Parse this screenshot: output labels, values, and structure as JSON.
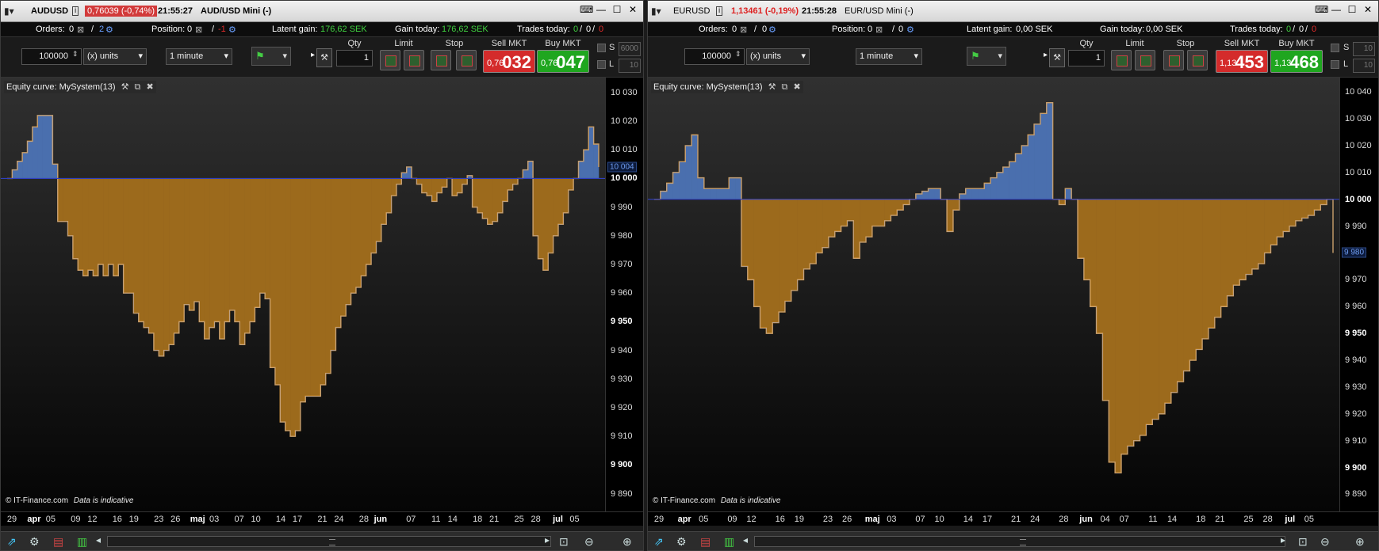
{
  "panels": [
    {
      "title": {
        "symbol": "AUDUSD",
        "price": "0,76039 (-0,74%)",
        "time": "21:55:27",
        "instrument": "AUD/USD Mini (-)"
      },
      "info": {
        "orders_label": "Orders:",
        "orders_value": "0",
        "orders_sep": "/",
        "orders_total": "2",
        "position_label": "Position:",
        "position_value": "0",
        "position_sep": "/",
        "position_total": "-1",
        "latent_label": "Latent gain:",
        "latent_value": "176,62 SEK",
        "gain_label": "Gain today:",
        "gain_value": "176,62 SEK",
        "trades_label": "Trades today:",
        "trades_a": "0",
        "trades_b": "0",
        "trades_c": "0"
      },
      "order": {
        "quantity": "100000",
        "units": "(x) units",
        "timeframe": "1 minute",
        "qty_label": "Qty",
        "qty_value": "1",
        "limit_label": "Limit",
        "stop_label": "Stop",
        "sell_label": "Sell MKT",
        "buy_label": "Buy MKT",
        "sell_small": "0,76",
        "sell_big": "032",
        "buy_small": "0,76",
        "buy_big": "047",
        "s_label": "S",
        "l_label": "L",
        "s_value": "6000",
        "l_value": "10"
      },
      "chart": {
        "title": "Equity curve: MySystem(13)",
        "copyright": "© IT-Finance.com",
        "indicative": "Data is indicative",
        "current_marker": "10 004"
      },
      "chart_data": {
        "type": "area",
        "baseline": 10000,
        "ylim": [
          9886,
          10033
        ],
        "yticks": [
          "10 030",
          "10 020",
          "10 010",
          "10 000",
          "9 990",
          "9 980",
          "9 970",
          "9 960",
          "9 950",
          "9 940",
          "9 930",
          "9 920",
          "9 910",
          "9 900",
          "9 890"
        ],
        "ytick_values": [
          10030,
          10020,
          10010,
          10000,
          9990,
          9980,
          9970,
          9960,
          9950,
          9940,
          9930,
          9920,
          9910,
          9900,
          9890
        ],
        "ytick_bold": [
          false,
          false,
          false,
          true,
          false,
          false,
          false,
          false,
          true,
          false,
          false,
          false,
          false,
          true,
          false
        ],
        "xlabels": [
          "29",
          "apr",
          "05",
          "09",
          "12",
          "16",
          "19",
          "23",
          "26",
          "maj",
          "03",
          "07",
          "10",
          "14",
          "17",
          "21",
          "24",
          "28",
          "jun",
          "07",
          "11",
          "14",
          "18",
          "21",
          "25",
          "28",
          "jul",
          "05"
        ],
        "xlabel_index": [
          0,
          0.8,
          1.4,
          2.3,
          2.9,
          3.8,
          4.4,
          5.3,
          5.9,
          6.7,
          7.3,
          8.2,
          8.8,
          9.7,
          10.3,
          11.2,
          11.8,
          12.7,
          13.3,
          14.4,
          15.3,
          15.9,
          16.8,
          17.4,
          18.3,
          18.9,
          19.7,
          20.3
        ],
        "xlabel_bold": [
          false,
          true,
          false,
          false,
          false,
          false,
          false,
          false,
          false,
          true,
          false,
          false,
          false,
          false,
          false,
          false,
          false,
          false,
          true,
          false,
          false,
          false,
          false,
          false,
          false,
          false,
          true,
          false
        ],
        "x_span": 21,
        "values": [
          10000,
          10003,
          10006,
          10009,
          10013,
          10018,
          10022,
          10022,
          10022,
          10005,
          9985,
          9985,
          9980,
          9972,
          9968,
          9966,
          9968,
          9966,
          9970,
          9966,
          9970,
          9966,
          9970,
          9960,
          9960,
          9953,
          9950,
          9948,
          9946,
          9940,
          9938,
          9940,
          9942,
          9946,
          9950,
          9956,
          9954,
          9957,
          9950,
          9944,
          9948,
          9950,
          9944,
          9950,
          9954,
          9950,
          9942,
          9946,
          9950,
          9955,
          9960,
          9958,
          9934,
          9928,
          9915,
          9912,
          9910,
          9912,
          9922,
          9924,
          9924,
          9924,
          9928,
          9932,
          9940,
          9948,
          9952,
          9956,
          9960,
          9962,
          9966,
          9970,
          9974,
          9978,
          9984,
          9988,
          9994,
          9998,
          10002,
          10004,
          10000,
          9998,
          9995,
          9994,
          9992,
          9995,
          9997,
          10000,
          9994,
          9995,
          9998,
          10001,
          9990,
          9988,
          9986,
          9984,
          9985,
          9988,
          9992,
          9996,
          9998,
          10000,
          10003,
          10006,
          9980,
          9972,
          9968,
          9974,
          9980,
          9984,
          9988,
          9996,
          10000,
          10006,
          10010,
          10018,
          10012,
          10004
        ],
        "last_value": 10004
      },
      "bottom": {
        "icons": [
          "chart-add-icon",
          "settings-icon",
          "save-icon",
          "bars-icon",
          "scroll-left-icon",
          "scroll-right-icon",
          "zoom-fit-icon",
          "zoom-out-icon",
          "zoom-in-icon"
        ]
      }
    },
    {
      "title": {
        "symbol": "EURUSD",
        "price": "1,13461 (-0,19%)",
        "time": "21:55:28",
        "instrument": "EUR/USD Mini (-)"
      },
      "info": {
        "orders_label": "Orders:",
        "orders_value": "0",
        "orders_sep": "/",
        "orders_total": "0",
        "position_label": "Position:",
        "position_value": "0",
        "position_sep": "/",
        "position_total": "0",
        "latent_label": "Latent gain:",
        "latent_value": "0,00 SEK",
        "gain_label": "Gain today:",
        "gain_value": "0,00 SEK",
        "trades_label": "Trades today:",
        "trades_a": "0",
        "trades_b": "0",
        "trades_c": "0"
      },
      "order": {
        "quantity": "100000",
        "units": "(x) units",
        "timeframe": "1 minute",
        "qty_label": "Qty",
        "qty_value": "1",
        "limit_label": "Limit",
        "stop_label": "Stop",
        "sell_label": "Sell MKT",
        "buy_label": "Buy MKT",
        "sell_small": "1,13",
        "sell_big": "453",
        "buy_small": "1,13",
        "buy_big": "468",
        "s_label": "S",
        "l_label": "L",
        "s_value": "10",
        "l_value": "10"
      },
      "chart": {
        "title": "Equity curve: MySystem(13)",
        "copyright": "© IT-Finance.com",
        "indicative": "Data is indicative",
        "current_marker": "9 980"
      },
      "chart_data": {
        "type": "area",
        "baseline": 10000,
        "ylim": [
          9886,
          10043
        ],
        "yticks": [
          "10 040",
          "10 030",
          "10 020",
          "10 010",
          "10 000",
          "9 990",
          "9 980",
          "9 970",
          "9 960",
          "9 950",
          "9 940",
          "9 930",
          "9 920",
          "9 910",
          "9 900",
          "9 890"
        ],
        "ytick_values": [
          10040,
          10030,
          10020,
          10010,
          10000,
          9990,
          9980,
          9970,
          9960,
          9950,
          9940,
          9930,
          9920,
          9910,
          9900,
          9890
        ],
        "ytick_bold": [
          false,
          false,
          false,
          false,
          true,
          false,
          false,
          false,
          false,
          true,
          false,
          false,
          false,
          false,
          true,
          false
        ],
        "xlabels": [
          "29",
          "apr",
          "05",
          "09",
          "12",
          "16",
          "19",
          "23",
          "26",
          "maj",
          "03",
          "07",
          "10",
          "14",
          "17",
          "21",
          "24",
          "28",
          "jun",
          "04",
          "07",
          "11",
          "14",
          "18",
          "21",
          "25",
          "28",
          "jul",
          "05"
        ],
        "xlabel_index": [
          0,
          0.8,
          1.4,
          2.3,
          2.9,
          3.8,
          4.4,
          5.3,
          5.9,
          6.7,
          7.3,
          8.2,
          8.8,
          9.7,
          10.3,
          11.2,
          11.8,
          12.7,
          13.4,
          14.0,
          14.6,
          15.5,
          16.1,
          17.0,
          17.6,
          18.5,
          19.1,
          19.8,
          20.4
        ],
        "xlabel_bold": [
          false,
          true,
          false,
          false,
          false,
          false,
          false,
          false,
          false,
          true,
          false,
          false,
          false,
          false,
          false,
          false,
          false,
          false,
          true,
          false,
          false,
          false,
          false,
          false,
          false,
          false,
          false,
          true,
          false
        ],
        "x_span": 21,
        "values": [
          10000,
          10003,
          10006,
          10010,
          10014,
          10020,
          10024,
          10008,
          10004,
          10004,
          10004,
          10004,
          10008,
          10008,
          9975,
          9970,
          9960,
          9952,
          9950,
          9954,
          9958,
          9962,
          9966,
          9970,
          9974,
          9976,
          9980,
          9982,
          9986,
          9988,
          9990,
          9992,
          9978,
          9984,
          9986,
          9990,
          9990,
          9992,
          9994,
          9996,
          9998,
          10000,
          10002,
          10003,
          10004,
          10004,
          10000,
          9988,
          9996,
          10002,
          10004,
          10004,
          10004,
          10006,
          10008,
          10010,
          10012,
          10014,
          10017,
          10020,
          10024,
          10028,
          10032,
          10036,
          10000,
          9998,
          10004,
          10000,
          9978,
          9970,
          9960,
          9950,
          9925,
          9902,
          9898,
          9905,
          9908,
          9910,
          9912,
          9916,
          9918,
          9920,
          9924,
          9928,
          9932,
          9936,
          9940,
          9944,
          9948,
          9952,
          9956,
          9960,
          9964,
          9968,
          9970,
          9972,
          9974,
          9976,
          9980,
          9983,
          9986,
          9988,
          9990,
          9992,
          9993,
          9994,
          9996,
          9998,
          10000,
          9980
        ],
        "last_value": 9980
      },
      "bottom": {
        "icons": [
          "chart-add-icon",
          "settings-icon",
          "save-icon",
          "bars-icon",
          "scroll-left-icon",
          "scroll-right-icon",
          "zoom-fit-icon",
          "zoom-out-icon",
          "zoom-in-icon"
        ]
      }
    }
  ],
  "colors": {
    "up_fill": "#4a6fae",
    "down_fill": "#9c6a1c",
    "up_line": "#7aa0ee",
    "down_line": "#f0a030",
    "baseline": "#3040c0"
  },
  "glyphs": {
    "window_menu": "▾",
    "keyboard": "⌨",
    "minimize": "—",
    "restore": "☐",
    "close": "✕",
    "info": "i",
    "gear": "⚙",
    "x_box": "⊠",
    "spinner": "⇕",
    "caret": "▾",
    "play": "▸",
    "wrench": "🔧",
    "settings": "⚙",
    "pin": "⊞",
    "dock": "⊟",
    "close_circle": "✖",
    "chart_add": "📈",
    "save": "🖫",
    "bars": "▥",
    "left": "◂",
    "right": "▸",
    "zoom_fit": "⊕",
    "zoom_out": "⊖",
    "zoom_in": "⊕"
  }
}
